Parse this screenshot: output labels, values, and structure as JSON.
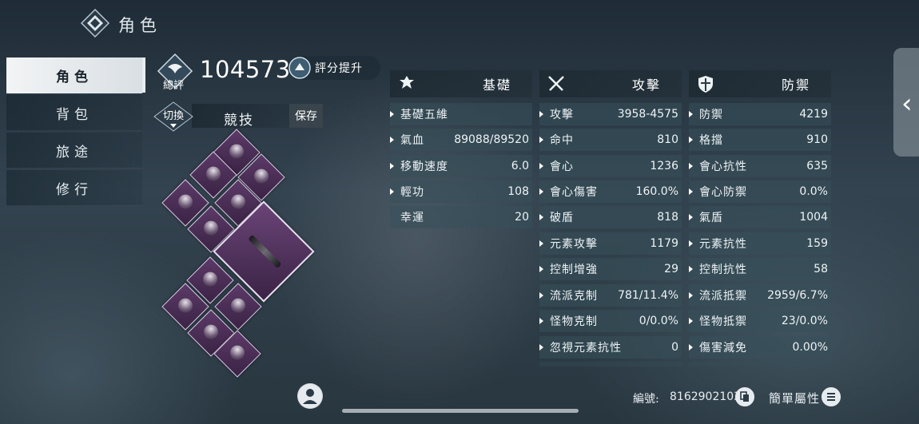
{
  "header": {
    "title": "角色",
    "logo_icon": "diamond-emblem-icon"
  },
  "nav": {
    "items": [
      {
        "label": "角色",
        "active": true
      },
      {
        "label": "背包",
        "active": false
      },
      {
        "label": "旅途",
        "active": false
      },
      {
        "label": "修行",
        "active": false
      }
    ]
  },
  "score": {
    "caption": "總評",
    "value": "104573",
    "boost_label": "評分提升",
    "icon": "score-emblem-icon"
  },
  "preset": {
    "switch_label": "切換",
    "name": "競技",
    "save_label": "保存"
  },
  "columns": {
    "basic": {
      "title": "基礎",
      "icon": "basic-emblem-icon",
      "rows": [
        {
          "label": "基礎五維",
          "value": ""
        },
        {
          "label": "氣血",
          "value": "89088/89520"
        },
        {
          "label": "移動速度",
          "value": "6.0"
        },
        {
          "label": "輕功",
          "value": "108"
        },
        {
          "label": "幸運",
          "value": "20"
        }
      ]
    },
    "attack": {
      "title": "攻擊",
      "icon": "crossed-swords-icon",
      "rows": [
        {
          "label": "攻擊",
          "value": "3958-4575"
        },
        {
          "label": "命中",
          "value": "810"
        },
        {
          "label": "會心",
          "value": "1236"
        },
        {
          "label": "會心傷害",
          "value": "160.0%"
        },
        {
          "label": "破盾",
          "value": "818"
        },
        {
          "label": "元素攻擊",
          "value": "1179"
        },
        {
          "label": "控制增強",
          "value": "29"
        },
        {
          "label": "流派克制",
          "value": "781/11.4%"
        },
        {
          "label": "怪物克制",
          "value": "0/0.0%"
        },
        {
          "label": "忽視元素抗性",
          "value": "0"
        }
      ]
    },
    "defense": {
      "title": "防禦",
      "icon": "shield-icon",
      "rows": [
        {
          "label": "防禦",
          "value": "4219"
        },
        {
          "label": "格擋",
          "value": "910"
        },
        {
          "label": "會心抗性",
          "value": "635"
        },
        {
          "label": "會心防禦",
          "value": "0.0%"
        },
        {
          "label": "氣盾",
          "value": "1004"
        },
        {
          "label": "元素抗性",
          "value": "159"
        },
        {
          "label": "控制抗性",
          "value": "58"
        },
        {
          "label": "流派抵禦",
          "value": "2959/6.7%"
        },
        {
          "label": "怪物抵禦",
          "value": "23/0.0%"
        },
        {
          "label": "傷害減免",
          "value": "0.00%"
        }
      ]
    }
  },
  "footer": {
    "uid_label": "編號:",
    "uid_value": "8162902103",
    "simple_label": "簡單屬性",
    "char_icon": "person-icon",
    "copy_icon": "copy-icon",
    "menu_icon": "menu-icon"
  },
  "side_tab": {
    "icon": "chevron-left-icon"
  }
}
